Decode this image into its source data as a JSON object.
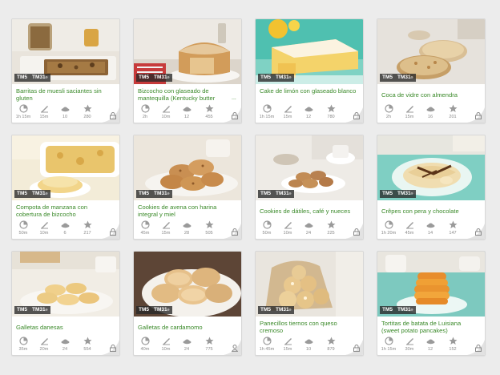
{
  "badges": {
    "tm5": "TM5",
    "tm31": "TM31",
    "tm31_mark": "®"
  },
  "colors": {
    "title": "#3b8a2a",
    "page_bg": "#ececec",
    "stat_text": "#8a8a8a"
  },
  "recipes": [
    {
      "title": "Barritas de muesli saciantes sin gluten",
      "total_time": "1h 15m",
      "prep_time": "15m",
      "portions": "10",
      "calories": "280",
      "access": "lock"
    },
    {
      "title": "Bizcocho con glaseado de mantequilla (Kentucky butter",
      "title_more": "...",
      "total_time": "2h",
      "prep_time": "10m",
      "portions": "12",
      "calories": "455",
      "access": "lock"
    },
    {
      "title": "Cake de limón con glaseado blanco",
      "total_time": "1h 15m",
      "prep_time": "15m",
      "portions": "12",
      "calories": "780",
      "access": "lock"
    },
    {
      "title": "Coca de vidre con almendra",
      "total_time": "2h",
      "prep_time": "15m",
      "portions": "16",
      "calories": "201",
      "access": "lock"
    },
    {
      "title": "Compota de manzana con cobertura de bizcocho",
      "total_time": "50m",
      "prep_time": "10m",
      "portions": "6",
      "calories": "217",
      "access": "lock"
    },
    {
      "title": "Cookies de avena con harina integral y miel",
      "total_time": "45m",
      "prep_time": "15m",
      "portions": "28",
      "calories": "505",
      "access": "lock"
    },
    {
      "title": "Cookies de dátiles, café y nueces",
      "total_time": "50m",
      "prep_time": "10m",
      "portions": "24",
      "calories": "225",
      "access": "lock"
    },
    {
      "title": "Crêpes con pera y chocolate",
      "total_time": "1h 20m",
      "prep_time": "45m",
      "portions": "14",
      "calories": "147",
      "access": "lock"
    },
    {
      "title": "Galletas danesas",
      "total_time": "35m",
      "prep_time": "20m",
      "portions": "24",
      "calories": "554",
      "access": "lock"
    },
    {
      "title": "Galletas de cardamomo",
      "total_time": "40m",
      "prep_time": "10m",
      "portions": "24",
      "calories": "775",
      "access": "lock"
    },
    {
      "title": "Panecillos tiernos con queso cremoso",
      "total_time": "1h 45m",
      "prep_time": "15m",
      "portions": "10",
      "calories": "879",
      "access": "lock"
    },
    {
      "title": "Tortitas de batata de Luisiana (sweet potato pancakes)",
      "total_time": "1h 15m",
      "prep_time": "30m",
      "portions": "12",
      "calories": "152",
      "access": "lock"
    }
  ]
}
